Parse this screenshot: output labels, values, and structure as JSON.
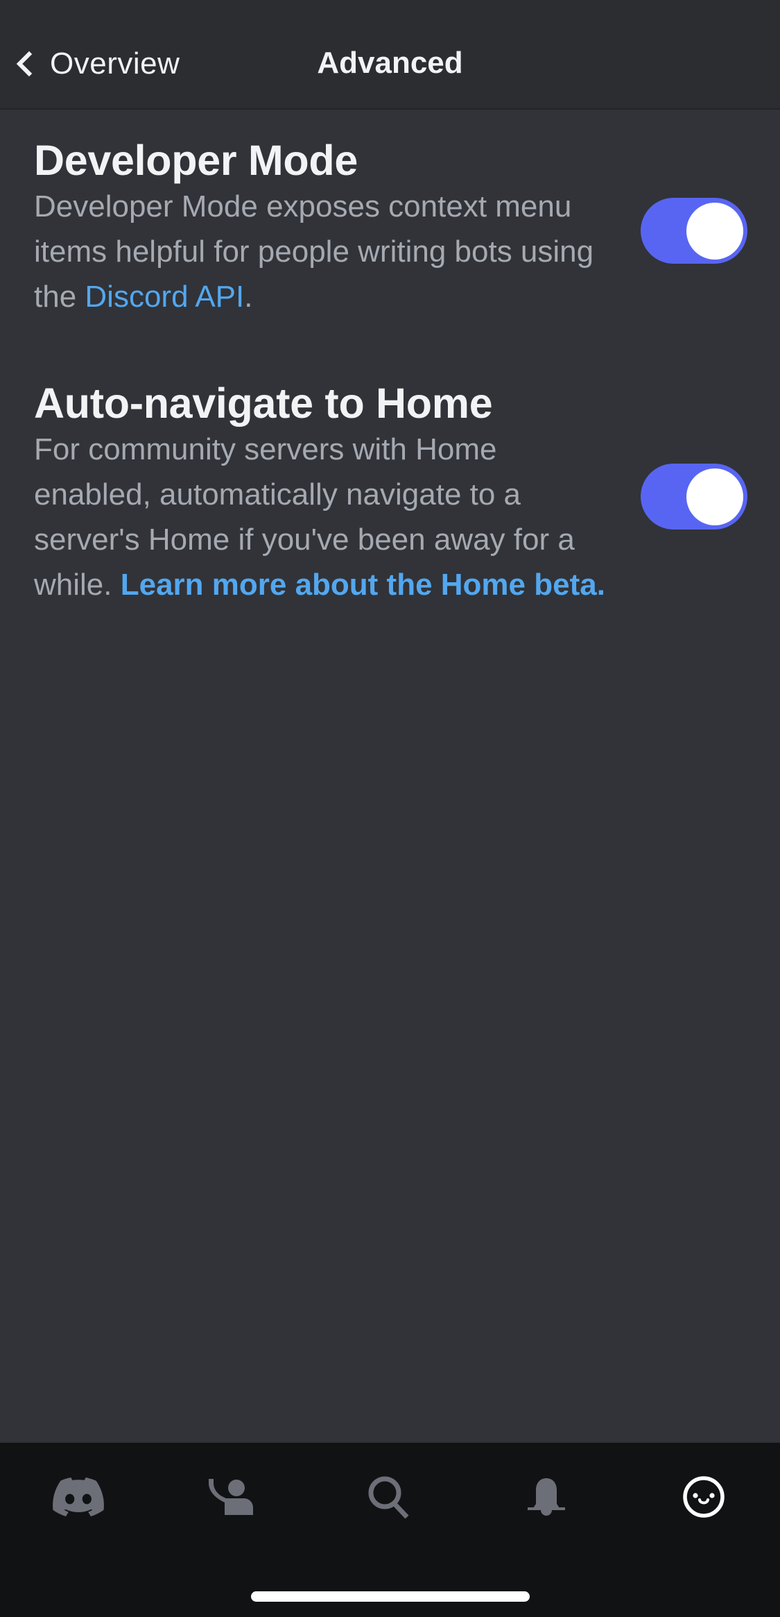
{
  "header": {
    "back_label": "Overview",
    "title": "Advanced"
  },
  "settings": [
    {
      "title": "Developer Mode",
      "description_prefix": "Developer Mode exposes context menu items helpful for people writing bots using the ",
      "link_text": "Discord API",
      "description_suffix": ".",
      "enabled": true
    },
    {
      "title": "Auto-navigate to Home",
      "description_prefix": "For community servers with Home enabled, automatically navigate to a server's Home if you've been away for a while. ",
      "link_text": "Learn more about the Home beta.",
      "description_suffix": "",
      "enabled": true
    }
  ],
  "bottom_nav": {
    "items": [
      {
        "name": "home",
        "icon": "discord-logo-icon",
        "active": false
      },
      {
        "name": "friends",
        "icon": "friends-wave-icon",
        "active": false
      },
      {
        "name": "search",
        "icon": "search-icon",
        "active": false
      },
      {
        "name": "notifications",
        "icon": "bell-icon",
        "active": false
      },
      {
        "name": "profile",
        "icon": "smile-profile-icon",
        "active": true
      }
    ]
  },
  "colors": {
    "background": "#313338",
    "header_bg": "#2b2d31",
    "nav_bg": "#111214",
    "accent": "#5865f2",
    "link": "#53a7ef",
    "text_primary": "#f2f3f5",
    "text_muted": "#a5a9b1",
    "icon_inactive": "#6d6f78"
  }
}
